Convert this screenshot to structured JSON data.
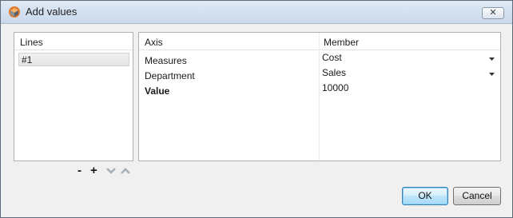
{
  "window": {
    "title": "Add values",
    "close_symbol": "✕"
  },
  "lines": {
    "header": "Lines",
    "items": [
      {
        "label": "#1"
      }
    ],
    "tools": {
      "remove": "-",
      "add": "+"
    }
  },
  "grid": {
    "columns": {
      "axis": "Axis",
      "member": "Member"
    },
    "rows": [
      {
        "axis": "Measures",
        "member": "Cost",
        "bold": false,
        "has_dropdown": true
      },
      {
        "axis": "Department",
        "member": "Sales",
        "bold": false,
        "has_dropdown": true
      },
      {
        "axis": "Value",
        "member": "10000",
        "bold": true,
        "has_dropdown": false
      }
    ]
  },
  "buttons": {
    "ok": "OK",
    "cancel": "Cancel"
  },
  "colors": {
    "accent": "#3c7fb1",
    "icon_orange": "#e07a2b"
  }
}
